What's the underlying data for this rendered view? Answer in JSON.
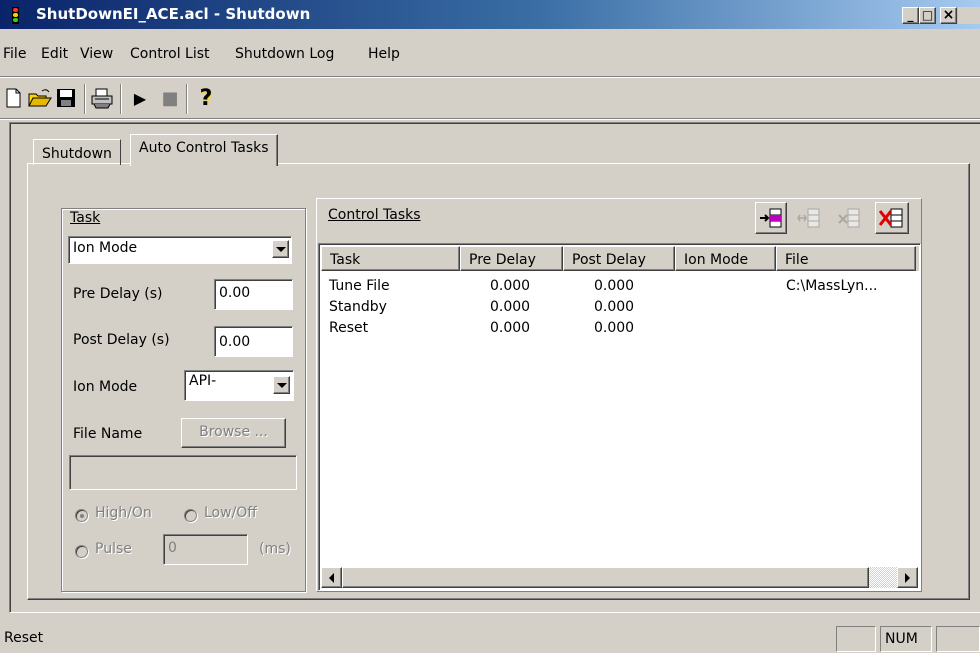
{
  "window": {
    "title": "ShutDownEI_ACE.acl - Shutdown",
    "minimize_glyph": "_",
    "maximize_glyph": "□",
    "close_glyph": "×"
  },
  "menu": {
    "file": "File",
    "edit": "Edit",
    "view": "View",
    "control_list": "Control List",
    "shutdown_log": "Shutdown Log",
    "help": "Help"
  },
  "toolbar": {
    "icons": [
      "new-document-icon",
      "open-folder-icon",
      "save-disk-icon",
      "print-icon",
      "play-icon",
      "stop-icon",
      "help-icon"
    ],
    "play_glyph": "▶",
    "stop_glyph": "■",
    "help_glyph": "?"
  },
  "tabs": {
    "shutdown": "Shutdown",
    "auto_control_tasks": "Auto Control Tasks"
  },
  "task_group": {
    "title": "Task",
    "task_select": "Ion Mode",
    "pre_delay_label": "Pre Delay (s)",
    "pre_delay_value": "0.00",
    "post_delay_label": "Post Delay (s)",
    "post_delay_value": "0.00",
    "ion_mode_label": "Ion Mode",
    "ion_mode_value": "API-",
    "file_name_label": "File Name",
    "browse_button": "Browse ...",
    "file_path_value": "",
    "high_on": "High/On",
    "low_off": "Low/Off",
    "pulse": "Pulse",
    "pulse_value": "0",
    "pulse_unit": "(ms)"
  },
  "control_tasks": {
    "title": "Control Tasks",
    "buttons": [
      "add-task-icon",
      "insert-task-icon",
      "remove-task-icon",
      "delete-task-icon"
    ],
    "columns": [
      "Task",
      "Pre Delay",
      "Post Delay",
      "Ion Mode",
      "File"
    ],
    "rows": [
      [
        "Tune File",
        "0.000",
        "0.000",
        "",
        "C:\\MassLyn..."
      ],
      [
        "Standby",
        "0.000",
        "0.000",
        "",
        ""
      ],
      [
        "Reset",
        "0.000",
        "0.000",
        "",
        ""
      ]
    ]
  },
  "statusbar": {
    "message": "Reset",
    "num": "NUM"
  },
  "colors": {
    "face": "#d4d0c8",
    "title_start": "#0a246a",
    "title_end": "#a6caf0",
    "delete_red": "#e00000"
  }
}
